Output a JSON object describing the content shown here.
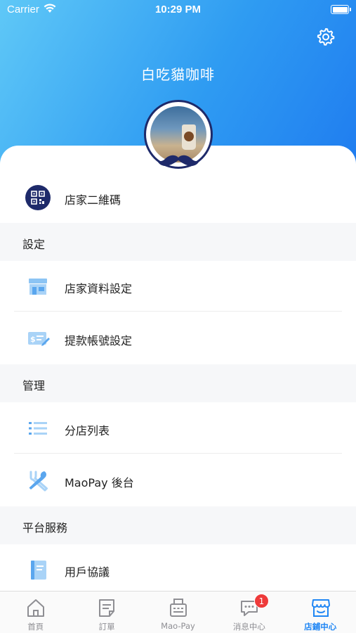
{
  "status_bar": {
    "carrier": "Carrier",
    "time": "10:29 PM"
  },
  "header": {
    "store_name": "白吃貓咖啡"
  },
  "qr_row": {
    "label": "店家二維碼"
  },
  "sections": {
    "settings": {
      "title": "設定",
      "items": [
        {
          "label": "店家資料設定",
          "icon": "store-icon"
        },
        {
          "label": "提款帳號設定",
          "icon": "payment-card-icon"
        }
      ]
    },
    "management": {
      "title": "管理",
      "items": [
        {
          "label": "分店列表",
          "icon": "list-icon"
        },
        {
          "label": "MaoPay 後台",
          "icon": "utensils-icon"
        }
      ]
    },
    "platform": {
      "title": "平台服務",
      "items": [
        {
          "label": "用戶協議",
          "icon": "book-icon"
        }
      ]
    }
  },
  "tabbar": {
    "tabs": [
      {
        "label": "首頁",
        "icon": "home-icon",
        "active": false
      },
      {
        "label": "訂單",
        "icon": "orders-icon",
        "active": false
      },
      {
        "label": "Mao-Pay",
        "icon": "pos-terminal-icon",
        "active": false
      },
      {
        "label": "消息中心",
        "icon": "message-icon",
        "active": false,
        "badge": "1"
      },
      {
        "label": "店鋪中心",
        "icon": "shop-icon",
        "active": true
      }
    ]
  },
  "colors": {
    "accent": "#1f86f4",
    "icon_blue": "#5aa6ee",
    "navy": "#1e2a6a",
    "badge": "#ee3a3a"
  }
}
